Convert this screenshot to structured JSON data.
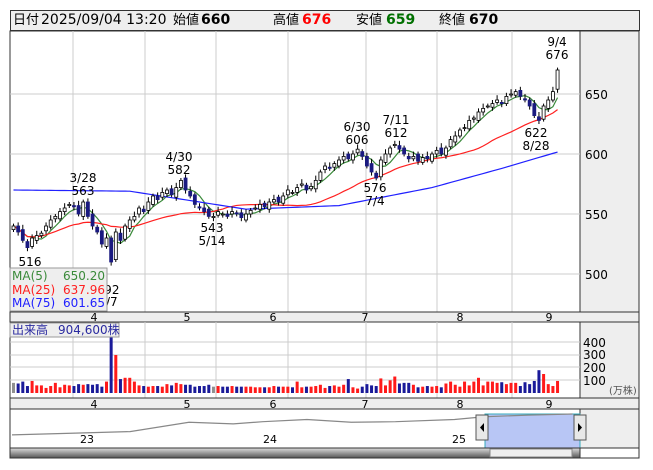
{
  "header": {
    "date_label": "日付",
    "datetime": "2025/09/04 13:20",
    "open_label": "始値",
    "open": "660",
    "high_label": "高値",
    "high": "676",
    "low_label": "安値",
    "low": "659",
    "close_label": "終値",
    "close": "670"
  },
  "colors": {
    "high": "#ff0000",
    "low": "#007000",
    "ma5": "#3a8a3a",
    "ma25": "#ff2020",
    "ma75": "#2020ff",
    "up_volume": "#ff1a1a",
    "down_volume": "#1a1a99",
    "flat_volume": "#909090",
    "down_candle": "#1a1a80"
  },
  "legend": {
    "ma5_label": "MA(5)",
    "ma5_value": "650.20",
    "ma25_label": "MA(25)",
    "ma25_value": "637.96",
    "ma75_label": "MA(75)",
    "ma75_value": "601.65"
  },
  "volume_label": {
    "title": "出来高",
    "value": "904,600株"
  },
  "annotations": [
    {
      "date": "9/4",
      "price": "676"
    },
    {
      "date": "3/28",
      "price": "563"
    },
    {
      "price": "516"
    },
    {
      "date": "4/7",
      "price": "492"
    },
    {
      "date": "4/30",
      "price": "582"
    },
    {
      "date": "5/14",
      "price": "543"
    },
    {
      "date": "6/30",
      "price": "606"
    },
    {
      "date": "7/4",
      "price": "576"
    },
    {
      "date": "7/11",
      "price": "612"
    },
    {
      "date": "8/28",
      "price": "622"
    }
  ],
  "chart_data": {
    "type": "candlestick",
    "price_axis": {
      "ticks": [
        "650",
        "600",
        "550",
        "500"
      ],
      "range": [
        468,
        700
      ]
    },
    "volume_axis": {
      "ticks": [
        "400",
        "300",
        "200",
        "100"
      ],
      "unit": "(万株)"
    },
    "month_labels": [
      "4",
      "5",
      "6",
      "7",
      "8",
      "9"
    ],
    "closes": [
      540,
      535,
      528,
      522,
      530,
      532,
      534,
      540,
      545,
      548,
      552,
      555,
      558,
      556,
      550,
      560,
      548,
      540,
      535,
      525,
      530,
      510,
      535,
      528,
      540,
      545,
      548,
      555,
      552,
      560,
      565,
      562,
      568,
      570,
      566,
      572,
      578,
      570,
      565,
      558,
      555,
      552,
      548,
      548,
      552,
      550,
      548,
      552,
      550,
      547,
      550,
      553,
      555,
      558,
      556,
      560,
      562,
      560,
      565,
      570,
      568,
      572,
      575,
      570,
      573,
      578,
      585,
      590,
      588,
      592,
      595,
      598,
      596,
      600,
      604,
      598,
      590,
      585,
      580,
      595,
      600,
      605,
      608,
      604,
      600,
      596,
      598,
      594,
      597,
      596,
      600,
      603,
      600,
      605,
      612,
      615,
      620,
      622,
      628,
      630,
      635,
      638,
      640,
      642,
      645,
      642,
      648,
      650,
      652,
      648,
      645,
      640,
      632,
      628,
      640,
      645,
      652,
      670
    ],
    "volumes": [
      80,
      75,
      90,
      55,
      95,
      60,
      60,
      40,
      55,
      80,
      45,
      65,
      60,
      55,
      70,
      65,
      70,
      65,
      70,
      50,
      90,
      450,
      300,
      110,
      120,
      120,
      90,
      60,
      55,
      50,
      55,
      55,
      50,
      70,
      60,
      80,
      70,
      65,
      65,
      50,
      55,
      55,
      65,
      50,
      55,
      50,
      50,
      55,
      50,
      50,
      50,
      50,
      45,
      45,
      45,
      45,
      55,
      50,
      50,
      50,
      45,
      90,
      45,
      50,
      50,
      55,
      65,
      40,
      55,
      60,
      50,
      65,
      110,
      45,
      35,
      50,
      70,
      60,
      55,
      115,
      60,
      100,
      130,
      75,
      80,
      80,
      65,
      45,
      50,
      55,
      50,
      55,
      45,
      75,
      90,
      65,
      50,
      90,
      60,
      90,
      120,
      60,
      90,
      90,
      80,
      85,
      70,
      80,
      80,
      55,
      85,
      70,
      95,
      180,
      150,
      70,
      55,
      95
    ],
    "ma75_anchors": [
      [
        0,
        570
      ],
      [
        25,
        569
      ],
      [
        50,
        554
      ],
      [
        70,
        557
      ],
      [
        90,
        572
      ],
      [
        105,
        588
      ],
      [
        117,
        601.65
      ]
    ],
    "navigator": {
      "labels": [
        "23",
        "24",
        "25"
      ],
      "series": [
        [
          0,
          562
        ],
        [
          20,
          565
        ],
        [
          40,
          568
        ],
        [
          60,
          585
        ],
        [
          75,
          582
        ],
        [
          85,
          586
        ],
        [
          100,
          590
        ],
        [
          115,
          585
        ],
        [
          130,
          586
        ],
        [
          150,
          590
        ],
        [
          160,
          595
        ],
        [
          175,
          598
        ],
        [
          190,
          600
        ]
      ]
    }
  }
}
